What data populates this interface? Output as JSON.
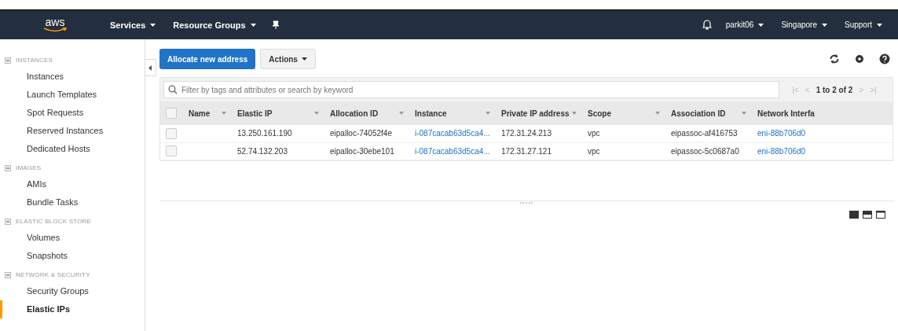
{
  "navbar": {
    "logo": "aws",
    "menus": [
      {
        "label": "Services"
      },
      {
        "label": "Resource Groups"
      }
    ],
    "right_menus": [
      {
        "label": "parkit06"
      },
      {
        "label": "Singapore"
      },
      {
        "label": "Support"
      }
    ]
  },
  "sidebar": {
    "groups": [
      {
        "title": "INSTANCES",
        "expanded": true,
        "items": [
          {
            "label": "Instances",
            "selected": false
          },
          {
            "label": "Launch Templates",
            "selected": false
          },
          {
            "label": "Spot Requests",
            "selected": false
          },
          {
            "label": "Reserved Instances",
            "selected": false
          },
          {
            "label": "Dedicated Hosts",
            "selected": false
          }
        ]
      },
      {
        "title": "IMAGES",
        "expanded": true,
        "items": [
          {
            "label": "AMIs",
            "selected": false
          },
          {
            "label": "Bundle Tasks",
            "selected": false
          }
        ]
      },
      {
        "title": "ELASTIC BLOCK STORE",
        "expanded": true,
        "items": [
          {
            "label": "Volumes",
            "selected": false
          },
          {
            "label": "Snapshots",
            "selected": false
          }
        ]
      },
      {
        "title": "NETWORK & SECURITY",
        "expanded": true,
        "items": [
          {
            "label": "Security Groups",
            "selected": false
          },
          {
            "label": "Elastic IPs",
            "selected": true
          }
        ]
      }
    ]
  },
  "toolbar": {
    "primary_button": "Allocate new address",
    "actions_button": "Actions"
  },
  "filter": {
    "placeholder": "Filter by tags and attributes or search by keyword"
  },
  "pagination": {
    "first": "|<",
    "previous": "<",
    "text": "1 to 2 of 2",
    "next": ">",
    "last": ">|"
  },
  "table": {
    "select_all_checked": false,
    "columns": [
      "Name",
      "Elastic IP",
      "Allocation ID",
      "Instance",
      "Private IP address",
      "Scope",
      "Association ID",
      "Network Interfa"
    ],
    "rows": [
      {
        "checked": false,
        "cells": [
          {
            "kind": "blank"
          },
          {
            "text": "13.250.161.190",
            "kind": "text"
          },
          {
            "text": "eipalloc-74052f4e",
            "kind": "text"
          },
          {
            "text": "i-087cacab63d5ca4...",
            "kind": "link"
          },
          {
            "text": "172.31.24.213",
            "kind": "text"
          },
          {
            "text": "vpc",
            "kind": "text"
          },
          {
            "text": "eipassoc-af416753",
            "kind": "text"
          },
          {
            "text": "eni-88b706d0",
            "kind": "link"
          }
        ]
      },
      {
        "checked": false,
        "cells": [
          {
            "kind": "blank"
          },
          {
            "text": "52.74.132.203",
            "kind": "text"
          },
          {
            "text": "eipalloc-30ebe101",
            "kind": "text"
          },
          {
            "text": "i-087cacab63d5ca4...",
            "kind": "link"
          },
          {
            "text": "172.31.27.121",
            "kind": "text"
          },
          {
            "text": "vpc",
            "kind": "text"
          },
          {
            "text": "eipassoc-5c0687a0",
            "kind": "text"
          },
          {
            "text": "eni-88b706d0",
            "kind": "link"
          }
        ]
      }
    ]
  }
}
